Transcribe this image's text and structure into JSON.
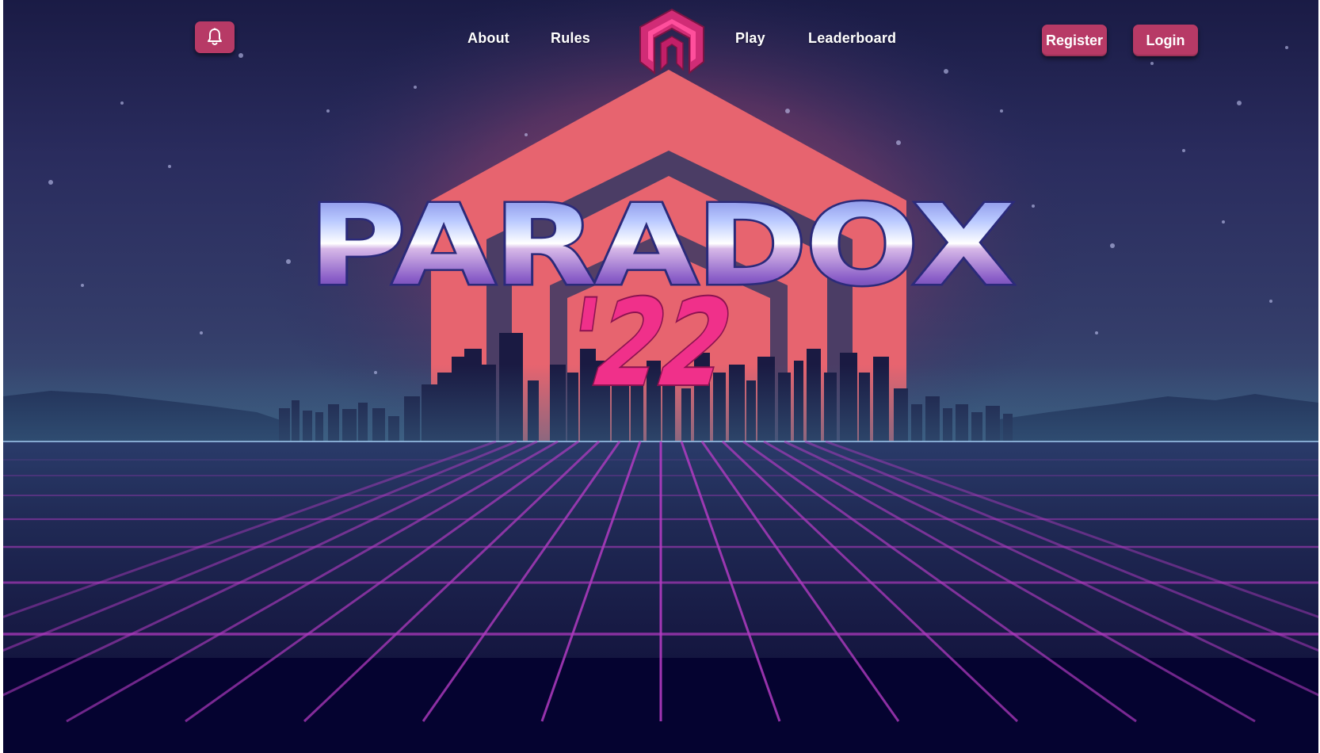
{
  "nav": {
    "left_links": [
      "About",
      "Rules"
    ],
    "right_links": [
      "Play",
      "Leaderboard"
    ],
    "register_label": "Register",
    "login_label": "Login",
    "bell_icon": "bell-icon",
    "logo_icon": "paradox-logo-icon"
  },
  "hero": {
    "title": "PARADOX",
    "year": "'22"
  },
  "colors": {
    "accent": "#b73a66",
    "background": "#1c1d4a",
    "sun": "#e7646f",
    "grid": "#b23bc2",
    "year_pink": "#f0308a"
  }
}
